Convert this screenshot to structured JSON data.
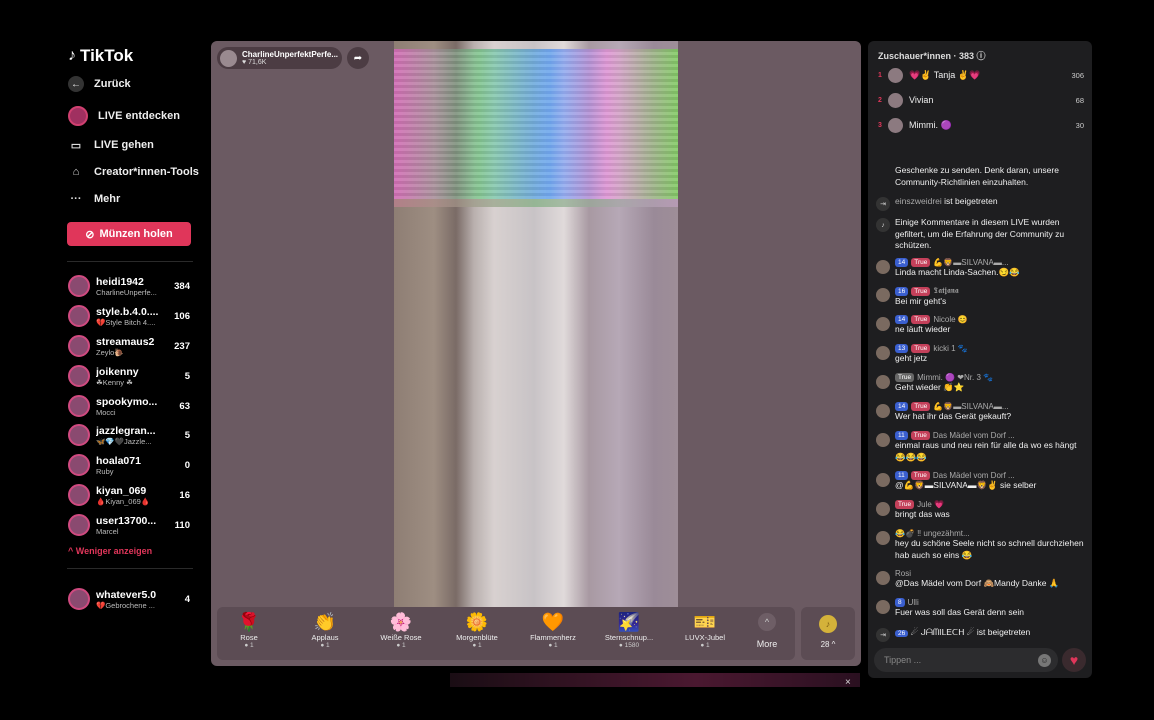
{
  "sidebar": {
    "logo": "TikTok",
    "back": "Zurück",
    "nav": [
      "LIVE entdecken",
      "LIVE gehen",
      "Creator*innen-Tools",
      "Mehr"
    ],
    "coins_button": "Münzen holen",
    "creators": [
      {
        "name": "heidi1942",
        "sub": "CharlineUnperfe...",
        "count": "384"
      },
      {
        "name": "style.b.4.0....",
        "sub": "💔Style Bitch 4....",
        "count": "106"
      },
      {
        "name": "streamaus2",
        "sub": "Zeylo🐌",
        "count": "237"
      },
      {
        "name": "joikenny",
        "sub": "☘Kenny ☘",
        "count": "5"
      },
      {
        "name": "spookymo...",
        "sub": "Mocci",
        "count": "63"
      },
      {
        "name": "jazzlegran...",
        "sub": "🦋💎🖤Jazzle...",
        "count": "5"
      },
      {
        "name": "hoala071",
        "sub": "Ruby",
        "count": "0"
      },
      {
        "name": "kiyan_069",
        "sub": "🩸Kiyan_069🩸",
        "count": "16"
      },
      {
        "name": "user13700...",
        "sub": "Marcel",
        "count": "110"
      }
    ],
    "show_less": "Weniger anzeigen",
    "following": {
      "name": "whatever5.0",
      "sub": "💔Gebrochene ...",
      "count": "4"
    }
  },
  "stream": {
    "host_name": "CharlineUnperfektPerfe...",
    "host_likes": "♥ 71,6K"
  },
  "gifts": [
    {
      "icon": "🌹",
      "name": "Rose",
      "price": "1"
    },
    {
      "icon": "👏",
      "name": "Applaus",
      "price": "1"
    },
    {
      "icon": "🌸",
      "name": "Weiße Rose",
      "price": "1"
    },
    {
      "icon": "🌼",
      "name": "Morgenblüte",
      "price": "1"
    },
    {
      "icon": "🧡",
      "name": "Flammenherz",
      "price": "1"
    },
    {
      "icon": "🌠",
      "name": "Sternschnup...",
      "price": "1580"
    },
    {
      "icon": "🎫",
      "name": "LUVX-Jubel",
      "price": "1"
    }
  ],
  "gift_more": "More",
  "coins_count": "28 ^",
  "chat": {
    "header": "Zuschauer*innen · 383 ⓘ",
    "viewers": [
      {
        "rank": "1",
        "name": "💗✌ Tanja ✌💗",
        "score": "306"
      },
      {
        "rank": "2",
        "name": "Vivian",
        "score": "68"
      },
      {
        "rank": "3",
        "name": "Mimmi. 🟣",
        "score": "30"
      }
    ],
    "messages": [
      {
        "type": "system",
        "text": "Geschenke zu senden. Denk daran, unsere Community-Richtlinien einzuhalten."
      },
      {
        "type": "join",
        "user": "einszweidrei",
        "text": "ist beigetreten"
      },
      {
        "type": "system",
        "text": "Einige Kommentare in diesem LIVE wurden gefiltert, um die Erfahrung der Community zu schützen."
      },
      {
        "type": "user",
        "level": "14",
        "fan": "True",
        "user": "💪🦁▬SILVANA▬...",
        "text": "Linda macht Linda-Sachen.😏😂"
      },
      {
        "type": "user",
        "level": "16",
        "fan": "True",
        "user": "𝕿𝖆𝖙𝖏𝖆𝖓𝖆",
        "text": "Bei mir geht's"
      },
      {
        "type": "user",
        "level": "14",
        "fan": "True",
        "user": "Nicole 😊",
        "text": "ne läuft wieder"
      },
      {
        "type": "user",
        "level": "13",
        "fan": "True",
        "user": "kicki 1 🐾",
        "text": "geht jetz"
      },
      {
        "type": "user",
        "level": "",
        "fan": "True",
        "user": "Mimmi. 🟣 ❤Nr. 3 🐾",
        "text": "Geht wieder 👏⭐"
      },
      {
        "type": "user",
        "level": "14",
        "fan": "True",
        "user": "💪🦁▬SILVANA▬...",
        "text": "Wer hat ihr das Gerät gekauft?"
      },
      {
        "type": "user",
        "level": "11",
        "fan": "True",
        "user": "Das Mädel vom Dorf ...",
        "text": "einmal raus und neu rein für alle da wo es hängt 😂😂😂"
      },
      {
        "type": "user",
        "level": "11",
        "fan": "True",
        "user": "Das Mädel vom Dorf ...",
        "text": "@💪🦁▬SILVANA▬🦁✌ sie selber"
      },
      {
        "type": "user",
        "level": "",
        "fan": "True",
        "user": "Jule 💗",
        "text": "bringt das was"
      },
      {
        "type": "user",
        "level": "",
        "fan": "",
        "user": "😂💣 ‼ ungezähmt...",
        "text": "hey du schöne Seele nicht so schnell durchziehen hab auch so eins 😂"
      },
      {
        "type": "user",
        "level": "",
        "fan": "",
        "user": "Rosi",
        "text": "@Das Mädel vom Dorf 🙈Mandy Danke 🙏"
      },
      {
        "type": "user",
        "level": "8",
        "fan": "",
        "user": "Ulli",
        "text": "Fuer was soll das Gerät denn sein"
      },
      {
        "type": "join",
        "level": "26",
        "user": "☄ ᒍᗩᗰIᒪEᑕᕼ ☄",
        "text": "ist beigetreten"
      }
    ],
    "input_placeholder": "Tippen ..."
  }
}
